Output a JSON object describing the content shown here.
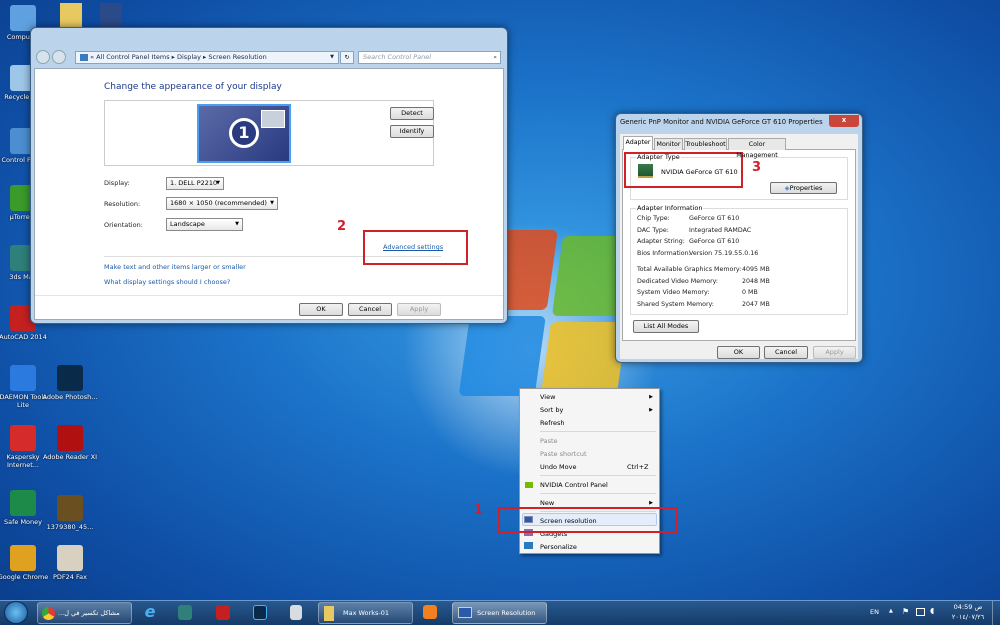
{
  "desktop": {
    "icons": [
      {
        "label": "Computer",
        "color": "#5fa0e0"
      },
      {
        "label": "Recycle Bin",
        "color": "#9ec6e8"
      },
      {
        "label": "Control Panel",
        "color": "#4b8fd0"
      },
      {
        "label": "µTorrent",
        "color": "#3a9a2a"
      },
      {
        "label": "3ds Max",
        "color": "#2f7f7a"
      },
      {
        "label": "AutoCAD 2014",
        "color": "#c42020"
      },
      {
        "label": "DAEMON Tools Lite",
        "color": "#2a7ae0"
      },
      {
        "label": "Kaspersky Internet...",
        "color": "#d62b2b"
      },
      {
        "label": "Safe Money",
        "color": "#1e8a4a"
      },
      {
        "label": "Google Chrome",
        "color": "#e0a020"
      },
      {
        "label": "Adobe Photosh...",
        "color": "#0a2a4a"
      },
      {
        "label": "Adobe Reader XI",
        "color": "#b01010"
      },
      {
        "label": "1379380_45...",
        "color": "#6a5020"
      },
      {
        "label": "PDF24 Fax",
        "color": "#d8d0c0"
      }
    ]
  },
  "screen_resolution": {
    "breadcrumb": [
      "All Control Panel Items",
      "Display",
      "Screen Resolution"
    ],
    "search_placeholder": "Search Control Panel",
    "heading": "Change the appearance of your display",
    "monitor_number": "1",
    "detect": "Detect",
    "identify": "Identify",
    "display_label": "Display:",
    "display_value": "1. DELL P2210",
    "resolution_label": "Resolution:",
    "resolution_value": "1680 × 1050 (recommended)",
    "orientation_label": "Orientation:",
    "orientation_value": "Landscape",
    "advanced_link": "Advanced settings",
    "link1": "Make text and other items larger or smaller",
    "link2": "What display settings should I choose?",
    "ok": "OK",
    "cancel": "Cancel",
    "apply": "Apply"
  },
  "properties": {
    "title": "Generic PnP Monitor and NVIDIA GeForce GT 610 Properties",
    "close": "x",
    "tabs": [
      "Adapter",
      "Monitor",
      "Troubleshoot",
      "Color Management"
    ],
    "adapter_type_label": "Adapter Type",
    "adapter_name": "NVIDIA GeForce GT 610",
    "properties_button": "Properties",
    "info_label": "Adapter Information",
    "info": [
      {
        "k": "Chip Type:",
        "v": "GeForce GT 610"
      },
      {
        "k": "DAC Type:",
        "v": "Integrated RAMDAC"
      },
      {
        "k": "Adapter String:",
        "v": "GeForce GT 610"
      },
      {
        "k": "Bios Information:",
        "v": "Version 75.19.55.0.16"
      }
    ],
    "memory": [
      {
        "k": "Total Available Graphics Memory:",
        "v": "4095 MB"
      },
      {
        "k": "Dedicated Video Memory:",
        "v": "2048 MB"
      },
      {
        "k": "System Video Memory:",
        "v": "0 MB"
      },
      {
        "k": "Shared System Memory:",
        "v": "2047 MB"
      }
    ],
    "list_modes": "List All Modes",
    "ok": "OK",
    "cancel": "Cancel",
    "apply": "Apply"
  },
  "context_menu": {
    "view": "View",
    "sort_by": "Sort by",
    "refresh": "Refresh",
    "paste": "Paste",
    "paste_shortcut": "Paste shortcut",
    "undo_move": "Undo Move",
    "undo_shortcut": "Ctrl+Z",
    "nvidia": "NVIDIA Control Panel",
    "new": "New",
    "screen_resolution": "Screen resolution",
    "gadgets": "Gadgets",
    "personalize": "Personalize"
  },
  "annotations": {
    "step1": "1",
    "step2": "2",
    "step3": "3"
  },
  "taskbar": {
    "chrome_label": "...مشاكل تكسير في ل",
    "folder_label": "Max Works-01",
    "screenres_label": "Screen Resolution",
    "lang": "EN",
    "time": "ص 04:59",
    "date": "٢٠١٤/٠٧/٢٦"
  }
}
